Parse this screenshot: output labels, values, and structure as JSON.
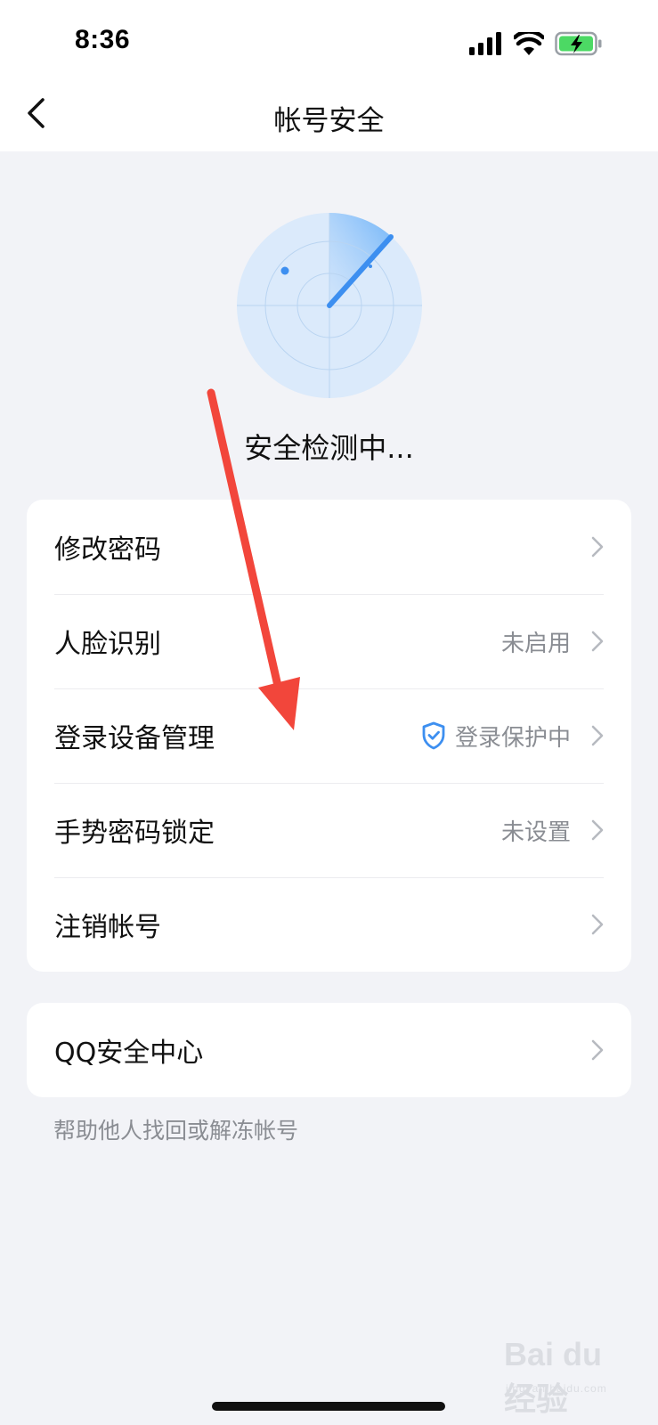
{
  "status_bar": {
    "time": "8:36"
  },
  "nav": {
    "title": "帐号安全"
  },
  "scan": {
    "status_text": "安全检测中..."
  },
  "security_items": [
    {
      "label": "修改密码",
      "value": ""
    },
    {
      "label": "人脸识别",
      "value": "未启用"
    },
    {
      "label": "登录设备管理",
      "value": "登录保护中",
      "icon": "shield-check-icon"
    },
    {
      "label": "手势密码锁定",
      "value": "未设置"
    },
    {
      "label": "注销帐号",
      "value": ""
    }
  ],
  "qq_center": {
    "label": "QQ安全中心"
  },
  "footnote": "帮助他人找回或解冻帐号",
  "watermark": {
    "logo_text": "Bai du 经验",
    "url_text": "jingyan.baidu.com"
  },
  "colors": {
    "accent": "#3d8ff0",
    "annotation_arrow": "#f2463b",
    "page_bg": "#f2f3f7"
  }
}
